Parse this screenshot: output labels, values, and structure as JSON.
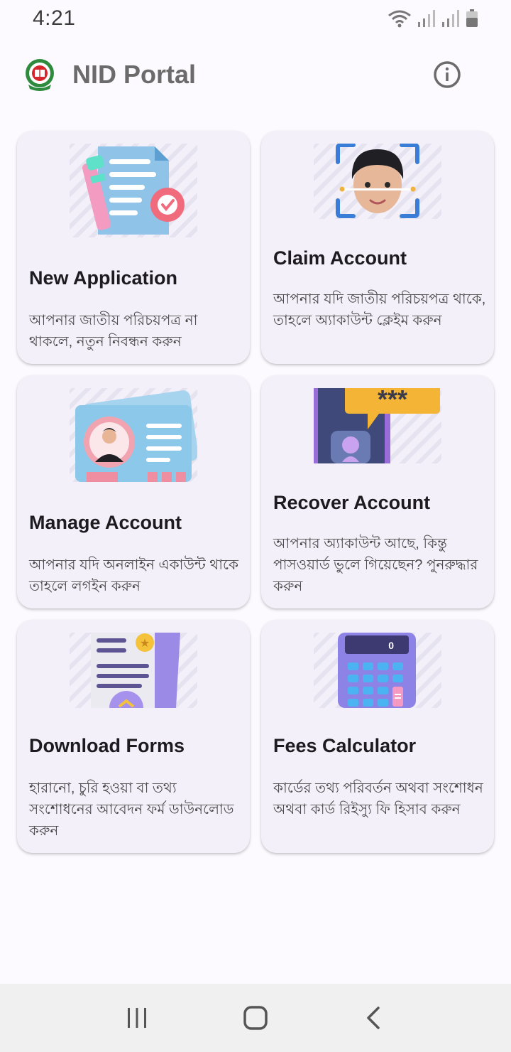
{
  "status_bar": {
    "time": "4:21",
    "icons": [
      "wifi-icon",
      "signal-icon",
      "signal-icon",
      "battery-icon"
    ]
  },
  "app_bar": {
    "title": "NID Portal",
    "logo": "government-seal-logo",
    "info_icon": "info-icon"
  },
  "cards": [
    {
      "title": "New Application",
      "description": "আপনার জাতীয় পরিচয়পত্র না থাকলে, নতুন নিবন্ধন করুন",
      "illustration": "document-pen-check-illustration"
    },
    {
      "title": "Claim Account",
      "description": "আপনার যদি জাতীয় পরিচয়পত্র থাকে, তাহলে অ্যাকাউন্ট ক্লেইম করুন",
      "illustration": "face-scan-illustration"
    },
    {
      "title": "Manage Account",
      "description": "আপনার যদি অনলাইন একাউন্ট থাকে তাহলে লগইন করুন",
      "illustration": "id-card-illustration"
    },
    {
      "title": "Recover Account",
      "description": "আপনার অ্যাকাউন্ট আছে, কিন্তু পাসওয়ার্ড ভুলে গিয়েছেন? পুনরুদ্ধার করুন",
      "illustration": "password-recovery-illustration",
      "password_mask": "***"
    },
    {
      "title": "Download Forms",
      "description": "হারানো, চুরি হওয়া বা তথ্য সংশোধনের আবেদন ফর্ম ডাউনলোড করুন",
      "illustration": "form-download-illustration"
    },
    {
      "title": "Fees Calculator",
      "description": "কার্ডের তথ্য পরিবর্তন অথবা সংশোধন অথবা কার্ড রিইস্যু ফি হিসাব করুন",
      "illustration": "calculator-illustration",
      "calculator_display": "0"
    }
  ],
  "nav_bar": {
    "buttons": [
      "recents-icon",
      "home-icon",
      "back-icon"
    ]
  }
}
